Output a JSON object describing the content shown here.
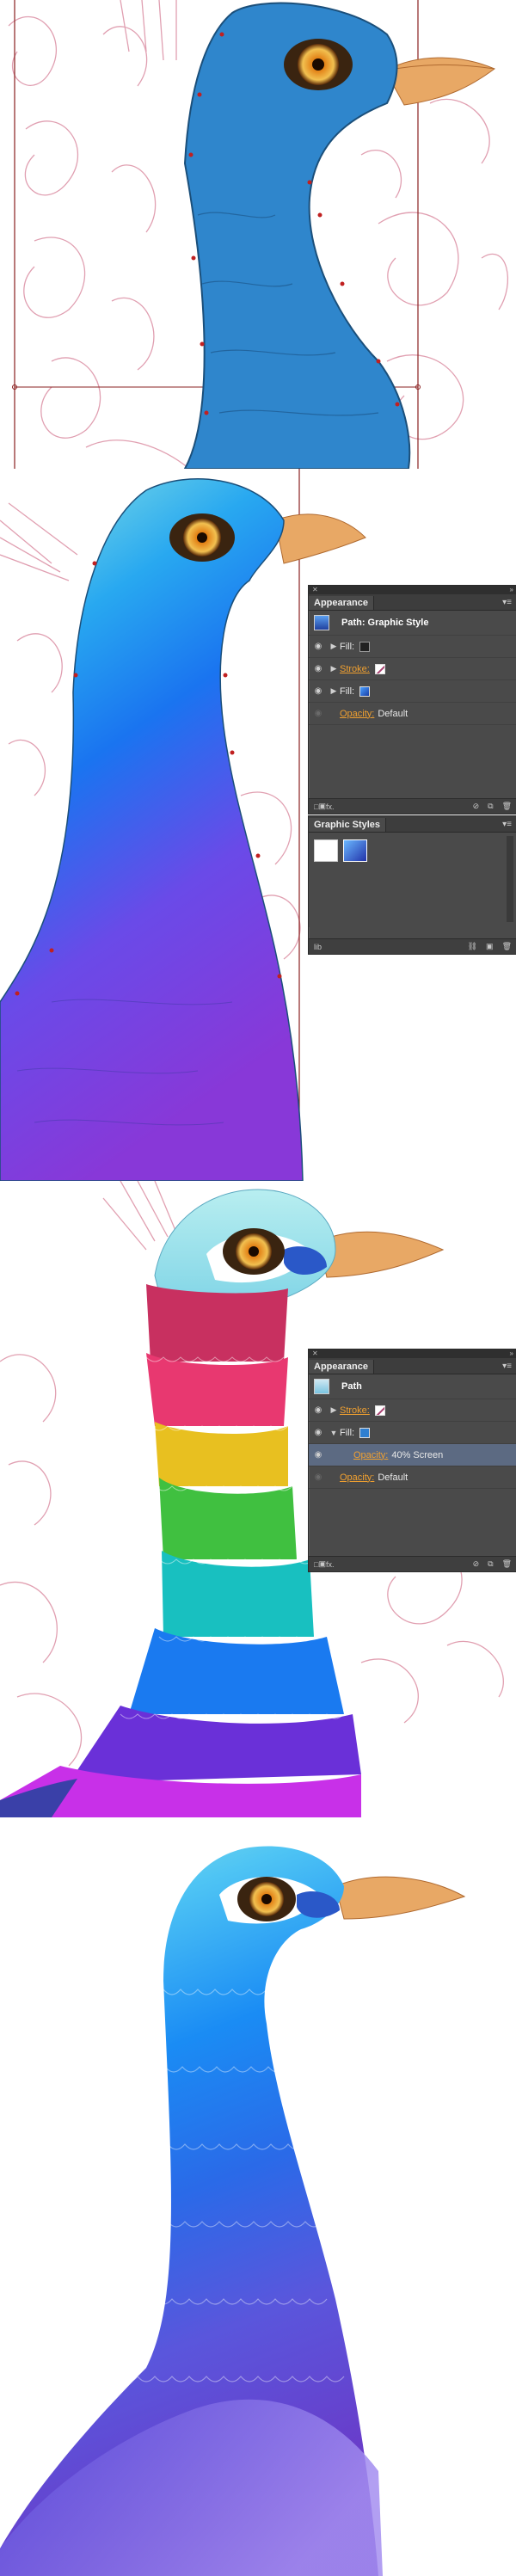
{
  "step2": {
    "appearance_panel": {
      "tab": "Appearance",
      "menu_icon": "panel-menu-icon",
      "header": "Path: Graphic Style",
      "rows": [
        {
          "label": "Fill:",
          "swatch": "dark"
        },
        {
          "label": "Stroke:",
          "swatch": "none"
        },
        {
          "label": "Fill:",
          "swatch": "blue-gradient"
        }
      ],
      "opacity_label": "Opacity:",
      "opacity_value": "Default",
      "footer_fx": "fx."
    },
    "graphic_styles_panel": {
      "tab": "Graphic Styles",
      "footer_icon": "library-icon"
    }
  },
  "step3": {
    "appearance_panel": {
      "tab": "Appearance",
      "header": "Path",
      "rows": [
        {
          "label": "Stroke:",
          "swatch": "none"
        },
        {
          "label": "Fill:",
          "swatch": "blue"
        }
      ],
      "sub_opacity_label": "Opacity:",
      "sub_opacity_value": "40% Screen",
      "opacity_label": "Opacity:",
      "opacity_value": "Default",
      "footer_fx": "fx."
    }
  },
  "colors": {
    "body_blue": "#2f86cc",
    "head_teal": "#7fdde0",
    "purple": "#7a48e0",
    "sketch": "#d9889e",
    "panel_bg": "#4a4a4a",
    "accent_orange": "#f0a030"
  }
}
